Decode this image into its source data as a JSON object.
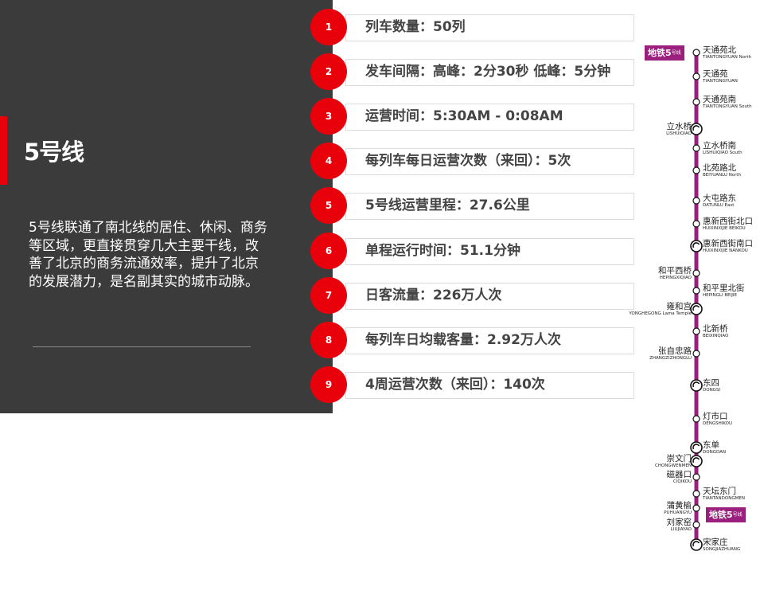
{
  "title": "5号线",
  "description": "5号线联通了南北线的居住、休闲、商务等区域，更直接贯穿几大主要干线，改善了北京的商务流通效率，提升了北京的发展潜力，是名副其实的城市动脉。",
  "stats": [
    {
      "num": "1",
      "text": "列车数量：50列"
    },
    {
      "num": "2",
      "text": "发车间隔：高峰：2分30秒   低峰：5分钟"
    },
    {
      "num": "3",
      "text": "运营时间：5:30AM - 0:08AM"
    },
    {
      "num": "4",
      "text": "每列车每日运营次数（来回）：5次"
    },
    {
      "num": "5",
      "text": "5号线运营里程：27.6公里"
    },
    {
      "num": "6",
      "text": "单程运行时间：51.1分钟"
    },
    {
      "num": "7",
      "text": "日客流量：226万人次"
    },
    {
      "num": "8",
      "text": "每列车日均载客量：2.92万人次"
    },
    {
      "num": "9",
      "text": "4周运营次数（来回）：140次"
    }
  ],
  "map": {
    "line_color": "#9b1f7d",
    "badge_top": {
      "main": "地铁5",
      "small": "号线"
    },
    "badge_bottom": {
      "main": "地铁5",
      "small": "号线"
    },
    "stations": [
      {
        "cn": "天通苑北",
        "en": "TIANTONGYUAN North",
        "side": "right",
        "transfer": false
      },
      {
        "cn": "天通苑",
        "en": "TIANTONGYUAN",
        "side": "right",
        "transfer": false
      },
      {
        "cn": "天通苑南",
        "en": "TIANTONGYUAN South",
        "side": "right",
        "transfer": false
      },
      {
        "cn": "立水桥",
        "en": "LISHUIQIAO",
        "side": "left",
        "transfer": true
      },
      {
        "cn": "立水桥南",
        "en": "LISHUIQIAO South",
        "side": "right",
        "transfer": false
      },
      {
        "cn": "北苑路北",
        "en": "BEIYUANLU North",
        "side": "right",
        "transfer": false
      },
      {
        "cn": "大屯路东",
        "en": "DATUNLU East",
        "side": "right",
        "transfer": false
      },
      {
        "cn": "惠新西街北口",
        "en": "HUIXINXIJIE BEIKOU",
        "side": "right",
        "transfer": false
      },
      {
        "cn": "惠新西街南口",
        "en": "HUIXINXIJIE NANKOU",
        "side": "right",
        "transfer": true
      },
      {
        "cn": "和平西桥",
        "en": "HEPINGXIQIAO",
        "side": "left",
        "transfer": false
      },
      {
        "cn": "和平里北街",
        "en": "HEPINGLI BEIJIE",
        "side": "right",
        "transfer": false
      },
      {
        "cn": "雍和宫",
        "en": "YONGHEGONG Lama Temple",
        "side": "left",
        "transfer": true
      },
      {
        "cn": "北新桥",
        "en": "BEIXINQIAO",
        "side": "right",
        "transfer": false
      },
      {
        "cn": "张自忠路",
        "en": "ZHANGZIZHONGLU",
        "side": "left",
        "transfer": false
      },
      {
        "cn": "东四",
        "en": "DONGSI",
        "side": "right",
        "transfer": true
      },
      {
        "cn": "灯市口",
        "en": "DENGSHIKOU",
        "side": "right",
        "transfer": false
      },
      {
        "cn": "东单",
        "en": "DONGDAN",
        "side": "right",
        "transfer": true
      },
      {
        "cn": "崇文门",
        "en": "CHONGWENMEN",
        "side": "left",
        "transfer": true
      },
      {
        "cn": "磁器口",
        "en": "CIQIKOU",
        "side": "left",
        "transfer": false
      },
      {
        "cn": "天坛东门",
        "en": "TIANTANDONGMEN",
        "side": "right",
        "transfer": false
      },
      {
        "cn": "蒲黄榆",
        "en": "PUHUANGYU",
        "side": "left",
        "transfer": false
      },
      {
        "cn": "刘家窑",
        "en": "LIUJIAYAO",
        "side": "left",
        "transfer": false
      },
      {
        "cn": "宋家庄",
        "en": "SONGJIAZHUANG",
        "side": "right",
        "transfer": true
      }
    ]
  }
}
